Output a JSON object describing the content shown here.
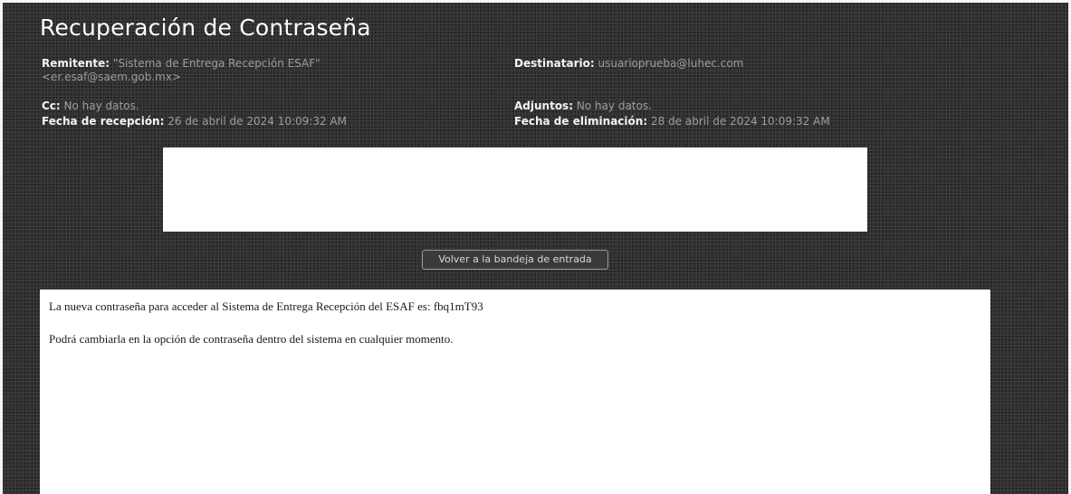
{
  "email": {
    "subject": "Recuperación de Contraseña",
    "sender": {
      "label": "Remitente:",
      "name": "\"Sistema de Entrega Recepción ESAF\"",
      "address": "<er.esaf@saem.gob.mx>"
    },
    "recipient": {
      "label": "Destinatario:",
      "value": "usuarioprueba@luhec.com"
    },
    "cc": {
      "label": "Cc:",
      "value": "No hay datos."
    },
    "attachments": {
      "label": "Adjuntos:",
      "value": "No hay datos."
    },
    "received": {
      "label": "Fecha de recepción:",
      "value": "26 de abril de 2024 10:09:32 AM"
    },
    "deletion": {
      "label": "Fecha de eliminación:",
      "value": "28 de abril de 2024 10:09:32 AM"
    }
  },
  "actions": {
    "back_to_inbox_label": "Volver a la bandeja de entrada"
  },
  "message_body": {
    "line1": "La nueva contraseña para acceder al Sistema de Entrega Recepción del ESAF es: fbq1mT93",
    "line2": "Podrá cambiarla en la opción de contraseña dentro del sistema en cualquier momento."
  }
}
